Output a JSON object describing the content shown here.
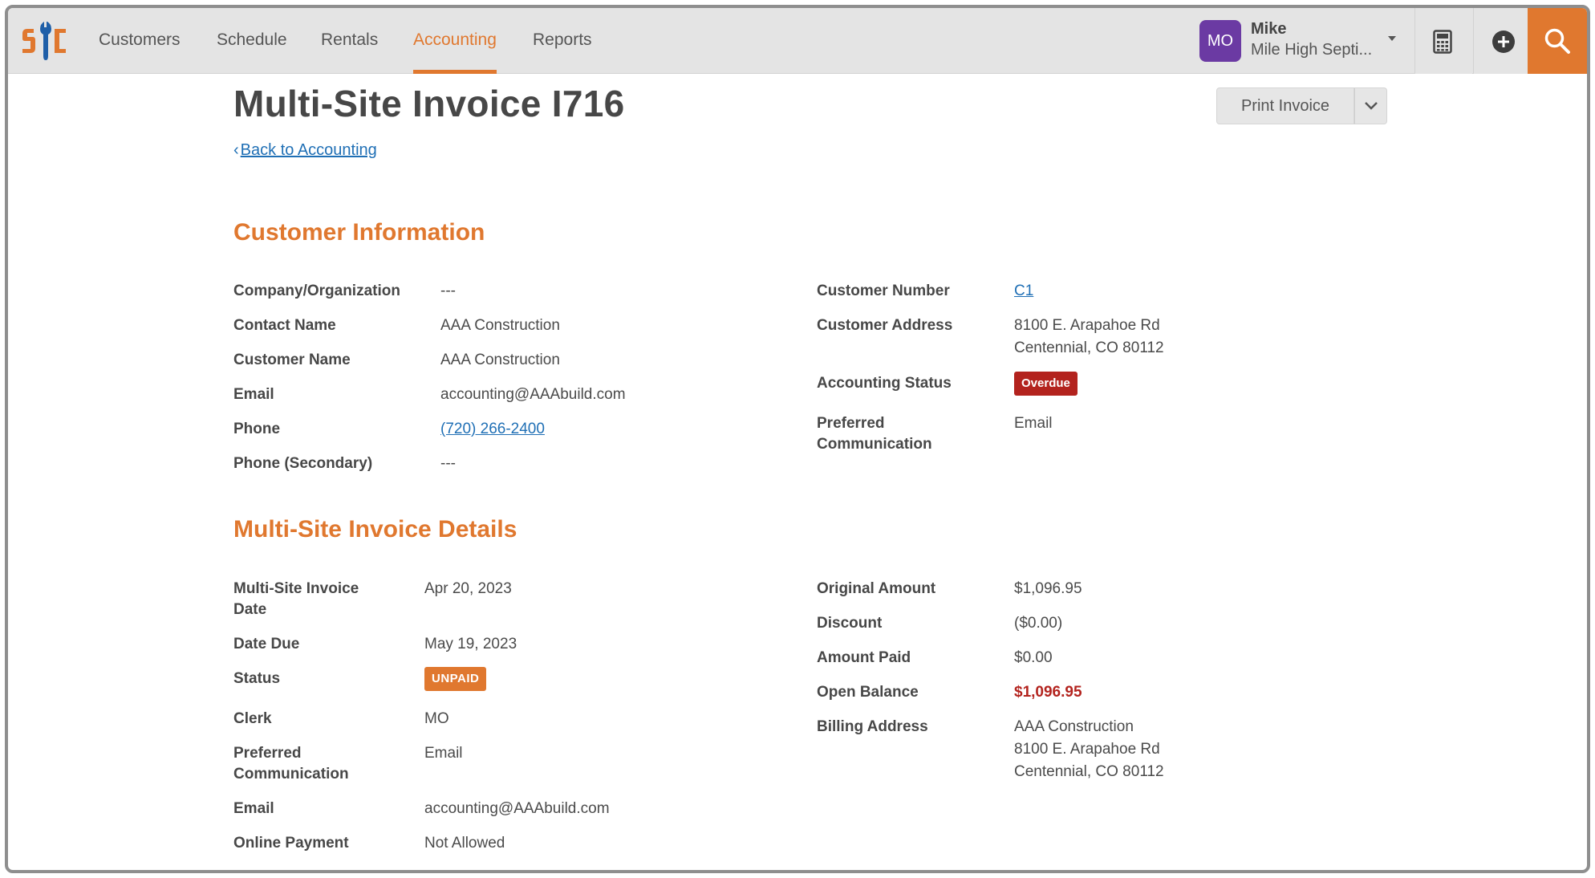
{
  "nav": {
    "items": [
      {
        "label": "Customers"
      },
      {
        "label": "Schedule"
      },
      {
        "label": "Rentals"
      },
      {
        "label": "Accounting",
        "active": true
      },
      {
        "label": "Reports"
      }
    ],
    "user": {
      "initials": "MO",
      "name": "Mike",
      "org": "Mile High Septi..."
    },
    "tools": {
      "calculator_icon": "calculator-icon",
      "add_icon": "plus-circle-icon",
      "search_icon": "search-icon"
    }
  },
  "page": {
    "title": "Multi-Site Invoice I716",
    "back_link": "Back to Accounting",
    "print_button": "Print Invoice"
  },
  "customer_info": {
    "heading": "Customer Information",
    "left": [
      {
        "label": "Company/Organization",
        "value": "---"
      },
      {
        "label": "Contact Name",
        "value": "AAA Construction"
      },
      {
        "label": "Customer Name",
        "value": "AAA Construction"
      },
      {
        "label": "Email",
        "value": "accounting@AAAbuild.com"
      },
      {
        "label": "Phone",
        "value": "(720) 266-2400"
      },
      {
        "label": "Phone (Secondary)",
        "value": "---"
      }
    ],
    "customer_number_label": "Customer Number",
    "customer_number": "C1",
    "customer_address_label": "Customer Address",
    "customer_address_line1": "8100 E. Arapahoe Rd",
    "customer_address_line2": "Centennial, CO 80112",
    "accounting_status_label": "Accounting Status",
    "accounting_status": "Overdue",
    "preferred_comm_label_1": "Preferred",
    "preferred_comm_label_2": "Communication",
    "preferred_comm": "Email"
  },
  "invoice_details": {
    "heading": "Multi-Site Invoice Details",
    "date_label_1": "Multi-Site Invoice",
    "date_label_2": "Date",
    "date": "Apr 20, 2023",
    "date_due_label": "Date Due",
    "date_due": "May 19, 2023",
    "status_label": "Status",
    "status": "UNPAID",
    "clerk_label": "Clerk",
    "clerk": "MO",
    "preferred_comm_label_1": "Preferred",
    "preferred_comm_label_2": "Communication",
    "preferred_comm": "Email",
    "email_label": "Email",
    "email": "accounting@AAAbuild.com",
    "online_payment_label": "Online Payment",
    "online_payment": "Not Allowed",
    "original_amount_label": "Original Amount",
    "original_amount": "$1,096.95",
    "discount_label": "Discount",
    "discount": "($0.00)",
    "amount_paid_label": "Amount Paid",
    "amount_paid": "$0.00",
    "open_balance_label": "Open Balance",
    "open_balance": "$1,096.95",
    "billing_address_label": "Billing Address",
    "billing_address_line1": "AAA Construction",
    "billing_address_line2": "8100 E. Arapahoe Rd",
    "billing_address_line3": "Centennial, CO 80112"
  },
  "colors": {
    "accent": "#e0782f",
    "danger": "#b3231e",
    "avatar": "#6b3aa3",
    "link": "#1f6fb5"
  }
}
